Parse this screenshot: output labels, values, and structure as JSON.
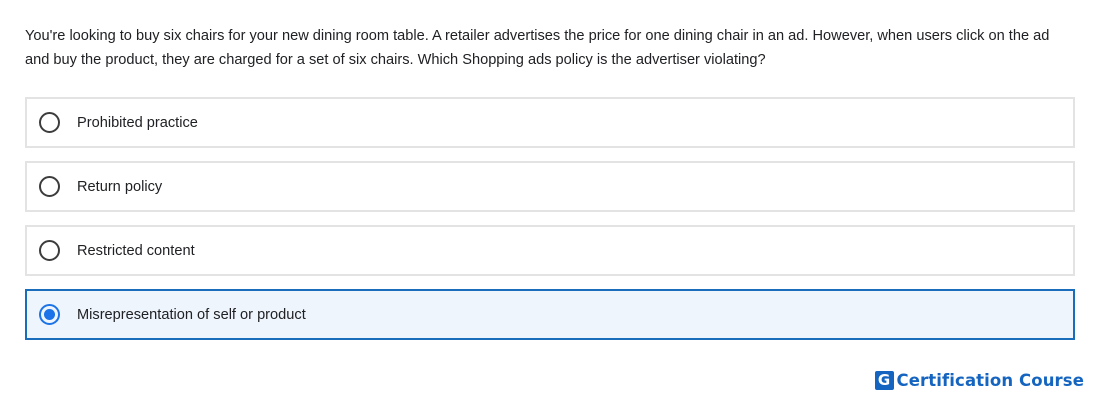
{
  "question": {
    "text": "You're looking to buy six chairs for your new dining room table. A retailer advertises the price for one dining chair in an ad. However, when users click on the ad and buy the product, they are charged for a set of six chairs. Which Shopping ads policy is the advertiser violating?"
  },
  "options": [
    {
      "label": "Prohibited practice",
      "selected": false
    },
    {
      "label": "Return policy",
      "selected": false
    },
    {
      "label": "Restricted content",
      "selected": false
    },
    {
      "label": "Misrepresentation of self or product",
      "selected": true
    }
  ],
  "brand": {
    "logo_letter": "G",
    "name": "Certification Course",
    "color": "#1565c0"
  },
  "colors": {
    "selected_border": "#1a6dbb",
    "selected_background": "#eef5fd",
    "radio_accent": "#1a73e8"
  }
}
